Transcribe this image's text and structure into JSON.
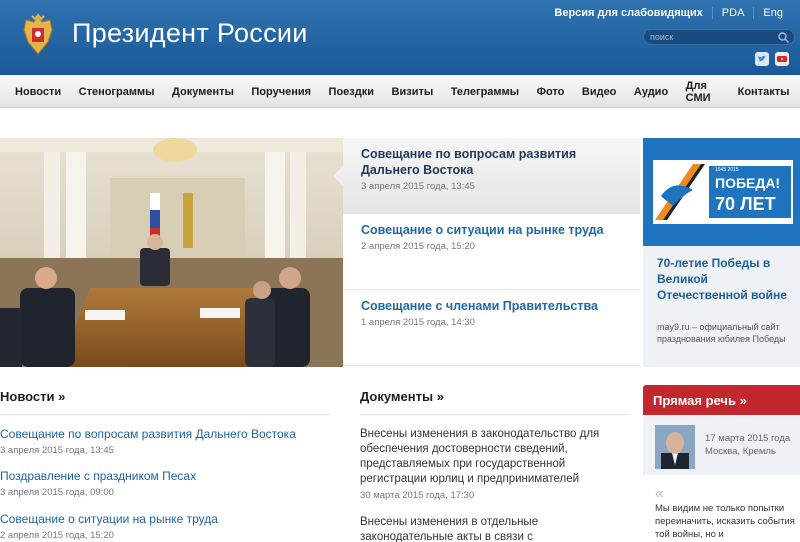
{
  "header": {
    "site_title": "Президент России",
    "top_links": [
      "Версия для слабовидящих",
      "PDA",
      "Eng"
    ],
    "search_placeholder": "поиск"
  },
  "nav": {
    "items": [
      "Новости",
      "Стенограммы",
      "Документы",
      "Поручения",
      "Поездки",
      "Визиты",
      "Телеграммы",
      "Фото",
      "Видео",
      "Аудио",
      "Для СМИ",
      "Контакты"
    ]
  },
  "feature": {
    "items": [
      {
        "title": "Совещание по вопросам развития Дальнего Востока",
        "date": "3 апреля 2015 года, 13:45"
      },
      {
        "title": "Совещание о ситуации на рынке труда",
        "date": "2 апреля 2015 года, 15:20"
      },
      {
        "title": "Совещание с членами Правительства",
        "date": "1 апреля 2015 года, 14:30"
      }
    ]
  },
  "promo": {
    "banner_text": "ПОБЕДА! 70 ЛЕТ",
    "banner_years": "1945 2015",
    "title": "70-летие Победы в Великой Отечественной войне",
    "description": "may9.ru – официальный сайт празднования юбилея Победы"
  },
  "news": {
    "heading": "Новости »",
    "items": [
      {
        "title": "Совещание по вопросам развития Дальнего Востока",
        "date": "3 апреля 2015 года, 13:45"
      },
      {
        "title": "Поздравление с праздником Песах",
        "date": "3 апреля 2015 года, 09:00"
      },
      {
        "title": "Совещание о ситуации на рынке труда",
        "date": "2 апреля 2015 года, 15:20"
      }
    ]
  },
  "documents": {
    "heading": "Документы »",
    "items": [
      {
        "title": "Внесены изменения в законодательство для обеспечения достоверности сведений, представляемых при государственной регистрации юрлиц и предпринимателей",
        "date": "30 марта 2015 года, 17:30"
      },
      {
        "title": "Внесены изменения в отдельные законодательные акты в связи с",
        "date": ""
      }
    ]
  },
  "speech": {
    "heading": "Прямая речь »",
    "date": "17 марта 2015 года",
    "place": "Москва, Кремль",
    "quote": "Мы видим не только попытки переиначить, исказить события той войны, но и"
  },
  "colors": {
    "header_blue": "#1f5f9f",
    "link_blue": "#1f62a6",
    "speech_red": "#c2272d",
    "promo_blue": "#1f74c0"
  }
}
